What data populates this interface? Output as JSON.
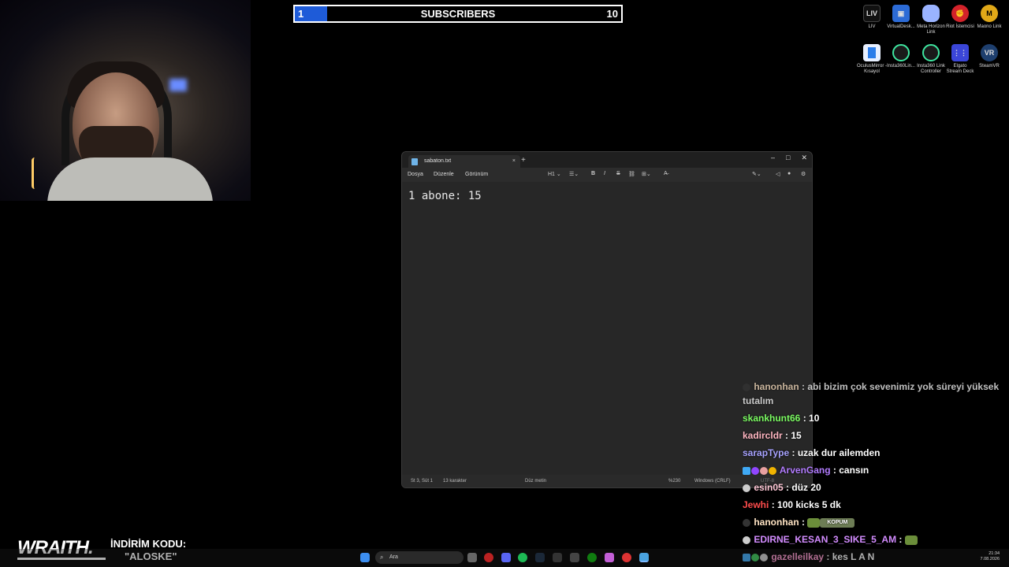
{
  "goal": {
    "label": "SUBSCRIBERS",
    "current": "1",
    "target": "10",
    "progress": 0.1
  },
  "desktop_icons": [
    {
      "name": "LIV",
      "color": "#111"
    },
    {
      "name": "VirtualDesk...",
      "color": "#2c6bd6"
    },
    {
      "name": "Meta Horizon Link",
      "color": "#9ab3ff"
    },
    {
      "name": "Riot İstemcisi",
      "color": "#d3222a"
    },
    {
      "name": "Maono Link",
      "color": "#e0a818"
    },
    {
      "name": "OculusMirror - Kısayol",
      "color": "#e8f0ff"
    },
    {
      "name": "Insta360Lin...",
      "color": "#1a1a1a"
    },
    {
      "name": "Insta360 Link Controller",
      "color": "#1a1a1a"
    },
    {
      "name": "Elgato Stream Deck",
      "color": "#3b46d8"
    },
    {
      "name": "SteamVR",
      "color": "#1e3f6e"
    }
  ],
  "notepad": {
    "tab_title": "sabaton.txt",
    "menu": [
      "Dosya",
      "Düzenle",
      "Görünüm"
    ],
    "heading_tool": "H1",
    "content": "1 abone: 15",
    "status": {
      "position": "St 3, Süt 1",
      "chars": "13 karakter",
      "format": "Düz metin",
      "zoom": "%230",
      "line_ending": "Windows (CRLF)",
      "encoding": "UTF-8"
    }
  },
  "chat": [
    {
      "user": "hanonhan",
      "user_color": "#ffe4c4",
      "text": "abi bizim çok sevenimiz yok süreyi yüksek tutalım",
      "dim": true
    },
    {
      "user": "skankhunt66",
      "user_color": "#7cfc63",
      "text": "10"
    },
    {
      "user": "kadircldr",
      "user_color": "#ffb6c1",
      "text": "15"
    },
    {
      "user": "sarapType",
      "user_color": "#a8a3ff",
      "text": "uzak dur ailemden"
    },
    {
      "user": "ArvenGang",
      "user_color": "#b27cff",
      "text": "cansın"
    },
    {
      "user": "esin05",
      "user_color": "#ffc8d6",
      "text": "düz 20"
    },
    {
      "user": "Jewhi",
      "user_color": "#ff4c4c",
      "text": "100 kicks 5 dk"
    },
    {
      "user": "hanonhan",
      "user_color": "#ffe4c4",
      "text": "",
      "emote": "KOPUM"
    },
    {
      "user": "EDIRNE_KESAN_3_SIKE_5_AM",
      "user_color": "#d38cff",
      "text": ""
    },
    {
      "user": "gazelleilkay",
      "user_color": "#ff9ad0",
      "text": "kes L A N"
    }
  ],
  "sponsor": {
    "brand": "WRAITH.",
    "label": "İNDİRİM KODU:",
    "code": "\"ALOSKE\""
  },
  "taskbar": {
    "search_placeholder": "Ara",
    "time": "21:34",
    "date": "7.08.2026"
  }
}
